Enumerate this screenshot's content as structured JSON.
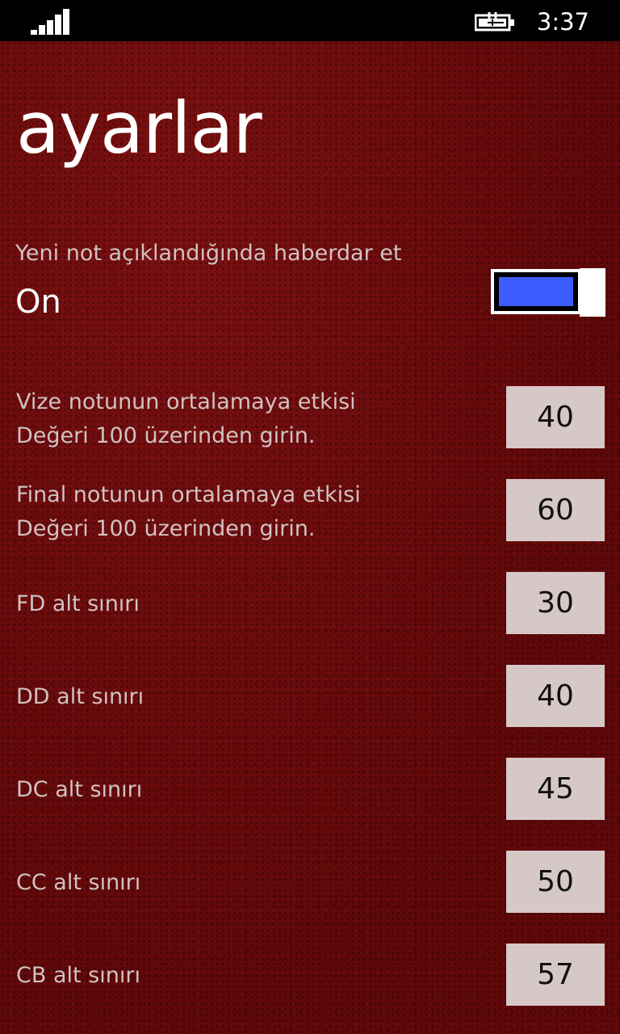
{
  "status_bar": {
    "signal_icon": "signal-strength-icon",
    "battery_icon": "battery-charging-icon",
    "time": "3:37"
  },
  "page": {
    "title": "ayarlar"
  },
  "notification": {
    "header": "Yeni not açıklandığında haberdar et",
    "value": "On",
    "enabled": true,
    "accent_color": "#3d5cff"
  },
  "settings": [
    {
      "label_line1": "Vize notunun ortalamaya etkisi",
      "label_line2": "Değeri 100 üzerinden girin.",
      "value": "40"
    },
    {
      "label_line1": "Final notunun ortalamaya etkisi",
      "label_line2": "Değeri 100 üzerinden girin.",
      "value": "60"
    },
    {
      "label_line1": "FD alt sınırı",
      "value": "30"
    },
    {
      "label_line1": "DD alt sınırı",
      "value": "40"
    },
    {
      "label_line1": "DC alt sınırı",
      "value": "45"
    },
    {
      "label_line1": "CC alt sınırı",
      "value": "50"
    },
    {
      "label_line1": "CB alt sınırı",
      "value": "57"
    }
  ],
  "colors": {
    "background": "#6e0b0c",
    "label_text": "#d2c1c1",
    "input_background": "#d7c8c8"
  }
}
